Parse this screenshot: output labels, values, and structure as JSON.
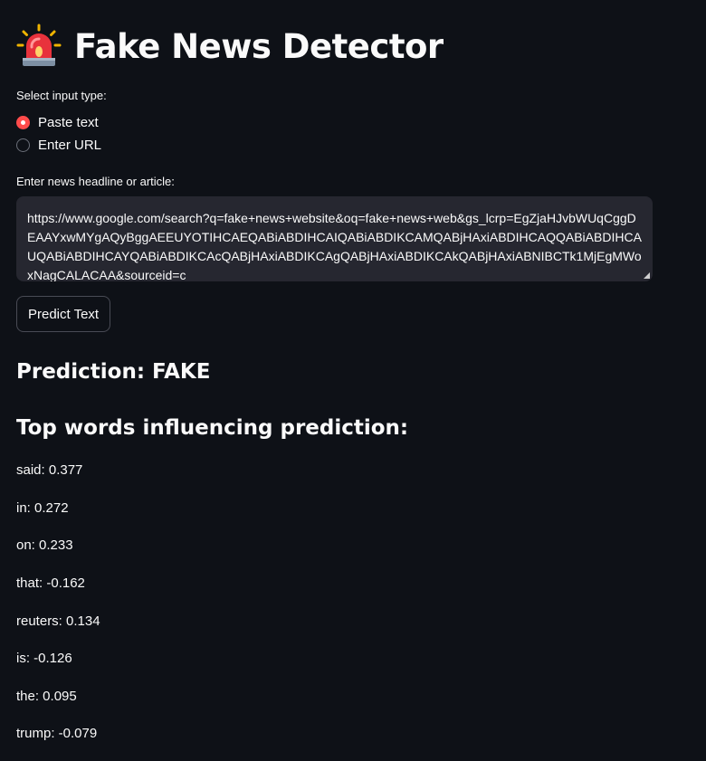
{
  "header": {
    "icon": "siren-icon",
    "title": "Fake News Detector"
  },
  "input_type": {
    "label": "Select input type:",
    "options": [
      "Paste text",
      "Enter URL"
    ],
    "selected": "Paste text"
  },
  "article": {
    "label": "Enter news headline or article:",
    "value": "https://www.google.com/search?q=fake+news+website&oq=fake+news+web&gs_lcrp=EgZjaHJvbWUqCggDEAAYxwMYgAQyBggAEEUYOTIHCAEQABiABDIHCAIQABiABDIKCAMQABjHAxiABDIHCAQQABiABDIHCAUQABiABDIHCAYQABiABDIKCAcQABjHAxiABDIKCAgQABjHAxiABDIKCAkQABjHAxiABNIBCTk1MjEgMWoxNagCALACAA&sourceid=c"
  },
  "predict_button": "Predict Text",
  "result": {
    "prediction": "Prediction: FAKE",
    "top_words_heading": "Top words influencing prediction:",
    "top_words": [
      "said: 0.377",
      "in: 0.272",
      "on: 0.233",
      "that: -0.162",
      "reuters: 0.134",
      "is: -0.126",
      "the: 0.095",
      "trump: -0.079"
    ]
  },
  "colors": {
    "background": "#0e1117",
    "accent": "#ff4b4b",
    "input_bg": "#262730"
  }
}
